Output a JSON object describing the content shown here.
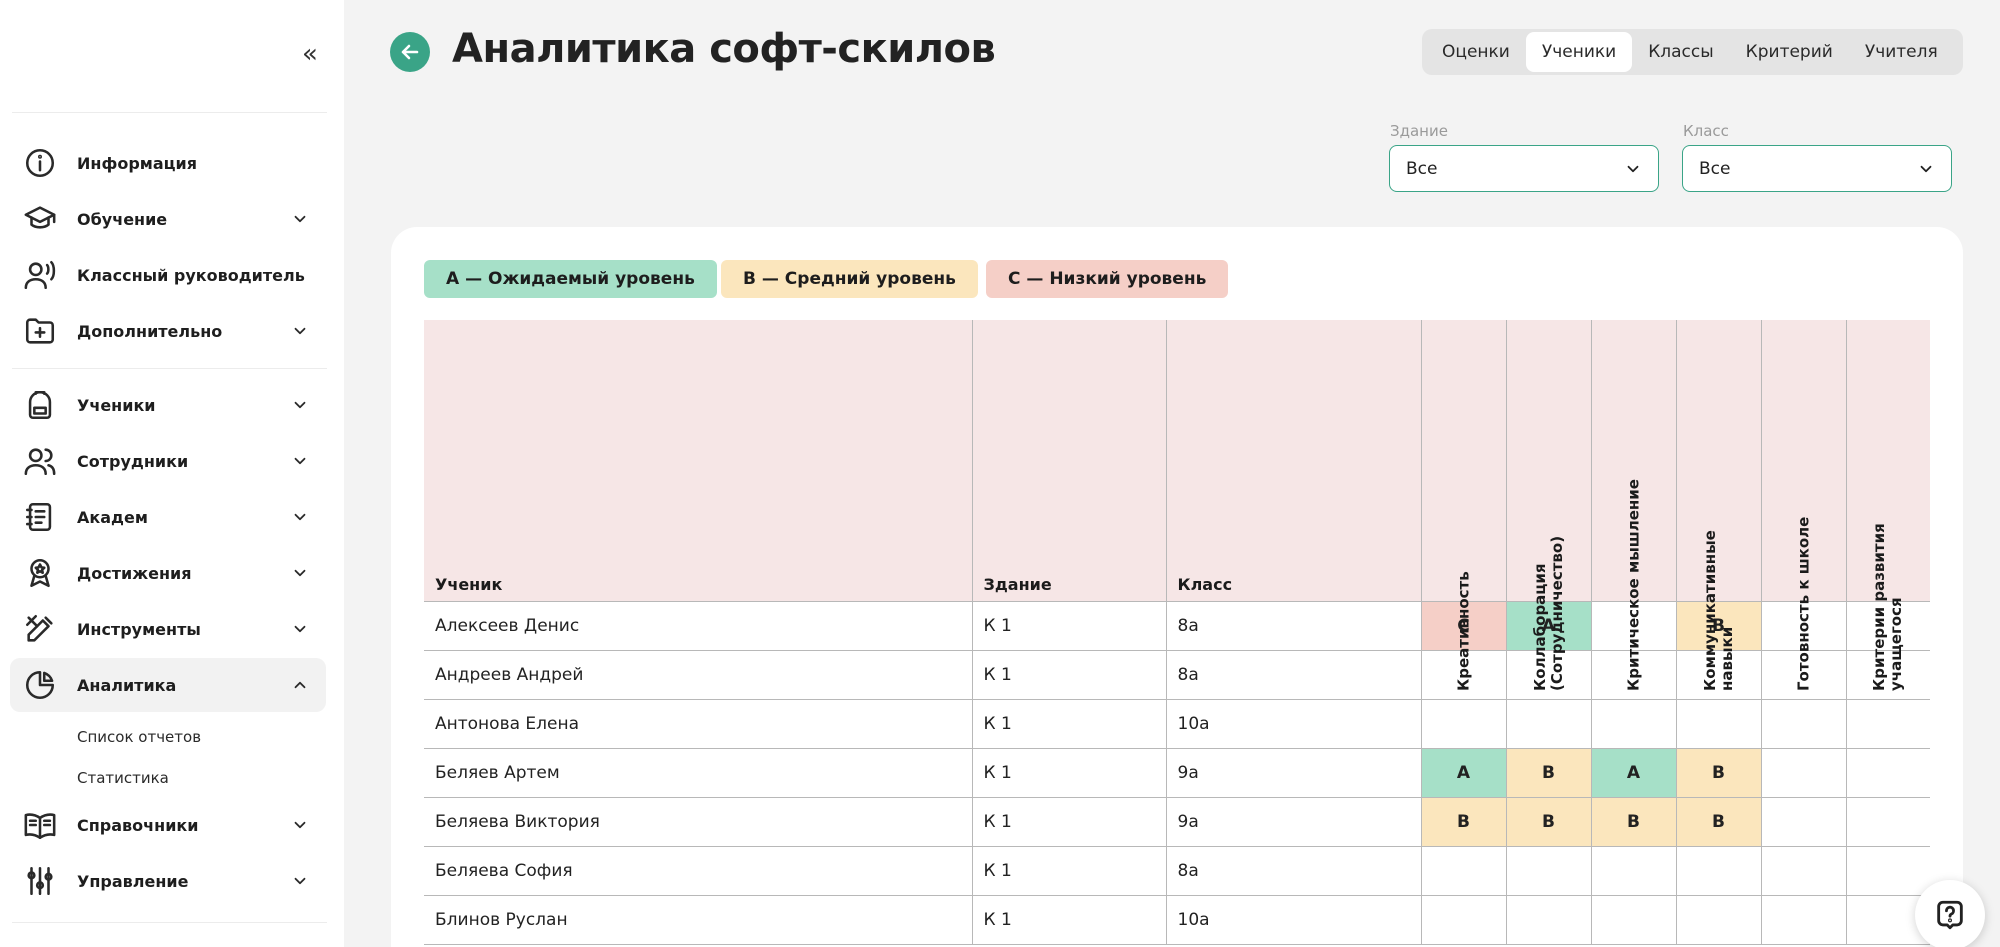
{
  "sidebar": {
    "groups": [
      [
        {
          "label": "Информация",
          "icon": "info-icon",
          "chevron": "none"
        }
      ],
      [
        {
          "label": "Обучение",
          "icon": "graduation-cap-icon",
          "chevron": "down"
        },
        {
          "label": "Классный руководитель",
          "icon": "user-voice-icon",
          "chevron": "none"
        },
        {
          "label": "Дополнительно",
          "icon": "folder-plus-icon",
          "chevron": "down"
        }
      ],
      [
        {
          "label": "Ученики",
          "icon": "backpack-icon",
          "chevron": "down"
        },
        {
          "label": "Сотрудники",
          "icon": "users-icon",
          "chevron": "down"
        },
        {
          "label": "Академ",
          "icon": "notebook-icon",
          "chevron": "down"
        },
        {
          "label": "Достижения",
          "icon": "award-icon",
          "chevron": "down"
        },
        {
          "label": "Инструменты",
          "icon": "tools-icon",
          "chevron": "down"
        },
        {
          "label": "Аналитика",
          "icon": "pie-chart-icon",
          "chevron": "up",
          "active": true
        }
      ],
      [
        {
          "label": "Справочники",
          "icon": "book-open-icon",
          "chevron": "down"
        },
        {
          "label": "Управление",
          "icon": "sliders-icon",
          "chevron": "down"
        }
      ]
    ],
    "analytics_sub": [
      "Список отчетов",
      "Статистика"
    ]
  },
  "header": {
    "title": "Аналитика софт-скилов",
    "tabs": [
      {
        "label": "Оценки",
        "active": false
      },
      {
        "label": "Ученики",
        "active": true
      },
      {
        "label": "Классы",
        "active": false
      },
      {
        "label": "Критерий",
        "active": false
      },
      {
        "label": "Учителя",
        "active": false
      }
    ]
  },
  "filters": {
    "building": {
      "label": "Здание",
      "value": "Все"
    },
    "class": {
      "label": "Класс",
      "value": "Все"
    }
  },
  "legend": [
    {
      "label": "A — Ожидаемый уровень",
      "color": "#a6e0c8"
    },
    {
      "label": "B — Средний уровень",
      "color": "#fbe6bd"
    },
    {
      "label": "C — Низкий уровень",
      "color": "#f5cfc7"
    }
  ],
  "table": {
    "columns": {
      "student": "Ученик",
      "building": "Здание",
      "class": "Класс",
      "skills": [
        "Креативность",
        "Коллаборация (Сотрудничество)",
        "Критическое мышление",
        "Коммуникативные навыки",
        "Готовность к школе",
        "Критерии развития учащегося"
      ]
    },
    "rows": [
      {
        "name": "Алексеев Денис",
        "building": "К 1",
        "class": "8а",
        "grades": [
          "C",
          "A",
          "",
          "B",
          "",
          ""
        ]
      },
      {
        "name": "Андреев Андрей",
        "building": "К 1",
        "class": "8а",
        "grades": [
          "",
          "",
          "",
          "",
          "",
          ""
        ]
      },
      {
        "name": "Антонова Елена",
        "building": "К 1",
        "class": "10а",
        "grades": [
          "",
          "",
          "",
          "",
          "",
          ""
        ]
      },
      {
        "name": "Беляев Артем",
        "building": "К 1",
        "class": "9а",
        "grades": [
          "A",
          "B",
          "A",
          "B",
          "",
          ""
        ]
      },
      {
        "name": "Беляева Виктория",
        "building": "К 1",
        "class": "9а",
        "grades": [
          "B",
          "B",
          "B",
          "B",
          "",
          ""
        ]
      },
      {
        "name": "Беляева София",
        "building": "К 1",
        "class": "8а",
        "grades": [
          "",
          "",
          "",
          "",
          "",
          ""
        ]
      },
      {
        "name": "Блинов Руслан",
        "building": "К 1",
        "class": "10а",
        "grades": [
          "",
          "",
          "",
          "",
          "",
          ""
        ]
      }
    ]
  },
  "colors": {
    "accent": "#3aa487",
    "header_bg": "#f6e6e6"
  }
}
